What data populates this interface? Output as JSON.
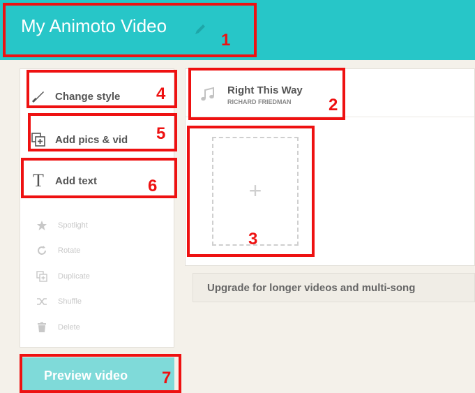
{
  "header": {
    "title": "My Animoto Video"
  },
  "sidebar": {
    "actions": [
      {
        "label": "Change style",
        "icon": "brush-icon"
      },
      {
        "label": "Add pics & vid",
        "icon": "add-media-icon"
      },
      {
        "label": "Add text",
        "icon": "text-icon"
      }
    ],
    "tools": [
      {
        "label": "Spotlight",
        "icon": "star-icon"
      },
      {
        "label": "Rotate",
        "icon": "rotate-icon"
      },
      {
        "label": "Duplicate",
        "icon": "duplicate-icon"
      },
      {
        "label": "Shuffle",
        "icon": "shuffle-icon"
      },
      {
        "label": "Delete",
        "icon": "trash-icon"
      }
    ]
  },
  "song": {
    "title": "Right This Way",
    "artist": "RICHARD FRIEDMAN"
  },
  "drop_zone": {
    "plus": "+"
  },
  "upgrade": {
    "text": "Upgrade for longer videos and multi-song"
  },
  "preview_button": {
    "label": "Preview video"
  },
  "callouts": [
    "1",
    "2",
    "3",
    "4",
    "5",
    "6",
    "7"
  ],
  "colors": {
    "header": "#27c6c8",
    "callout": "#ee1111",
    "preview": "#7fdad9"
  }
}
